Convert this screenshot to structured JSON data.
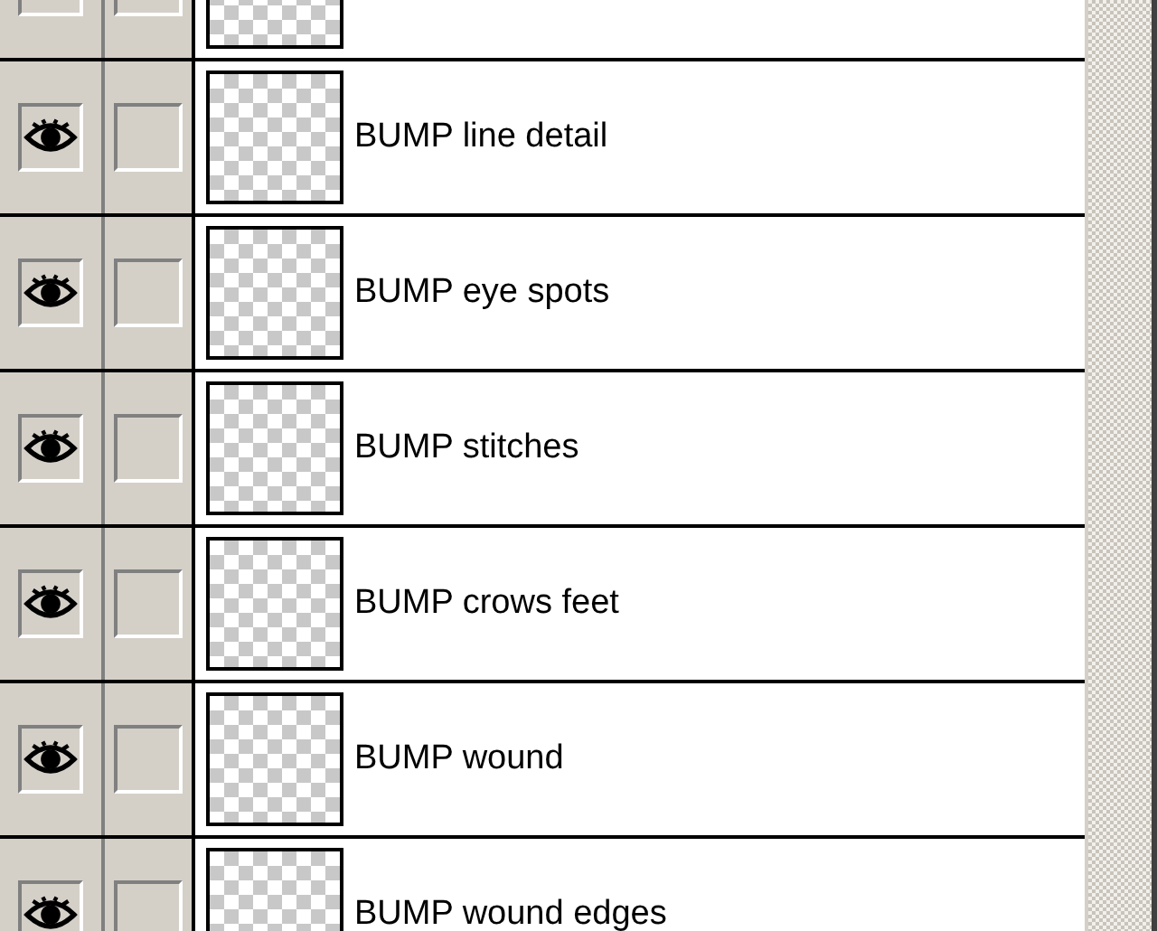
{
  "layers": [
    {
      "name": "BUMP line detail",
      "visible": true
    },
    {
      "name": "BUMP eye spots",
      "visible": true
    },
    {
      "name": "BUMP stitches",
      "visible": true
    },
    {
      "name": "BUMP crows feet",
      "visible": true
    },
    {
      "name": "BUMP wound",
      "visible": true
    },
    {
      "name": "BUMP wound edges",
      "visible": true
    }
  ]
}
